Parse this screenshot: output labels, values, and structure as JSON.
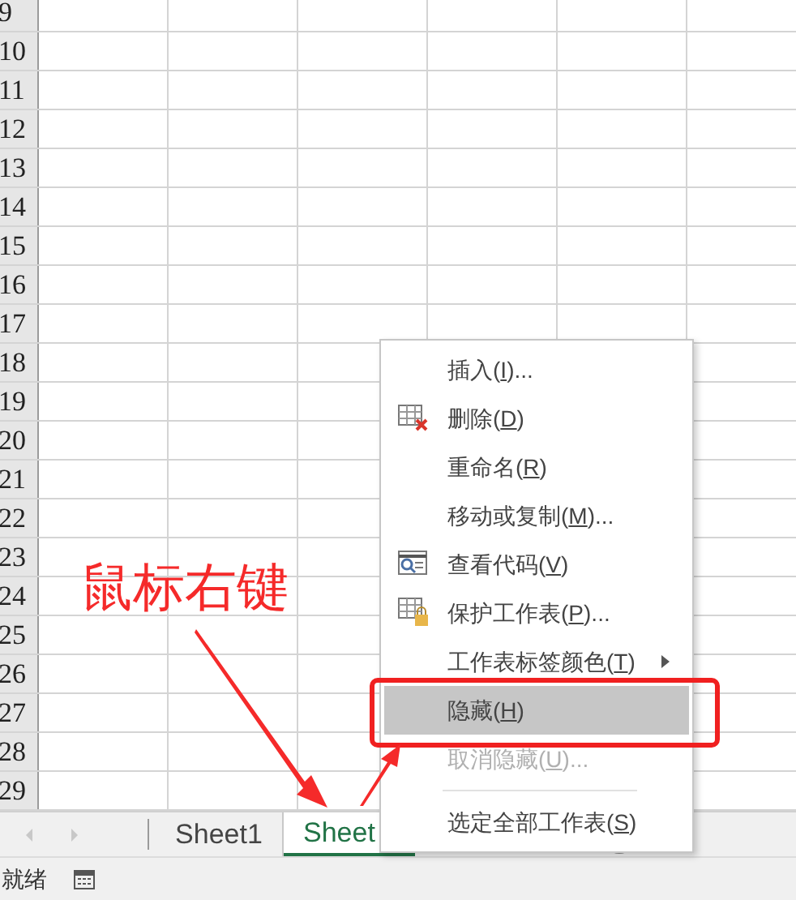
{
  "sheet": {
    "rows": [
      "9",
      "10",
      "11",
      "12",
      "13",
      "14",
      "15",
      "16",
      "17",
      "18",
      "19",
      "20",
      "21",
      "22",
      "23",
      "24",
      "25",
      "26",
      "27",
      "28",
      "29"
    ]
  },
  "tabs": [
    {
      "label": "Sheet1",
      "selected": false
    },
    {
      "label": "Sheet",
      "selected": true
    }
  ],
  "status_bar": {
    "text": "就绪"
  },
  "context_menu": [
    {
      "kind": "plain",
      "before": "插入(",
      "key": "I",
      "after": ")...",
      "submenu": false,
      "selected": false,
      "disabled": false
    },
    {
      "kind": "delete",
      "before": "删除(",
      "key": "D",
      "after": ")",
      "submenu": false,
      "selected": false,
      "disabled": false
    },
    {
      "kind": "plain",
      "before": "重命名(",
      "key": "R",
      "after": ")",
      "submenu": false,
      "selected": false,
      "disabled": false
    },
    {
      "kind": "plain",
      "before": "移动或复制(",
      "key": "M",
      "after": ")...",
      "submenu": false,
      "selected": false,
      "disabled": false
    },
    {
      "kind": "code",
      "before": "查看代码(",
      "key": "V",
      "after": ")",
      "submenu": false,
      "selected": false,
      "disabled": false
    },
    {
      "kind": "protect",
      "before": "保护工作表(",
      "key": "P",
      "after": ")...",
      "submenu": false,
      "selected": false,
      "disabled": false
    },
    {
      "kind": "plain",
      "before": "工作表标签颜色(",
      "key": "T",
      "after": ")",
      "submenu": true,
      "selected": false,
      "disabled": false
    },
    {
      "kind": "plain",
      "before": "隐藏(",
      "key": "H",
      "after": ")",
      "submenu": false,
      "selected": true,
      "disabled": false
    },
    {
      "kind": "plain",
      "before": "取消隐藏(",
      "key": "U",
      "after": ")...",
      "submenu": false,
      "selected": false,
      "disabled": true
    },
    {
      "kind": "separator"
    },
    {
      "kind": "plain",
      "before": "选定全部工作表(",
      "key": "S",
      "after": ")",
      "submenu": false,
      "selected": false,
      "disabled": false
    }
  ],
  "annotation": {
    "text": "鼠标右键"
  }
}
